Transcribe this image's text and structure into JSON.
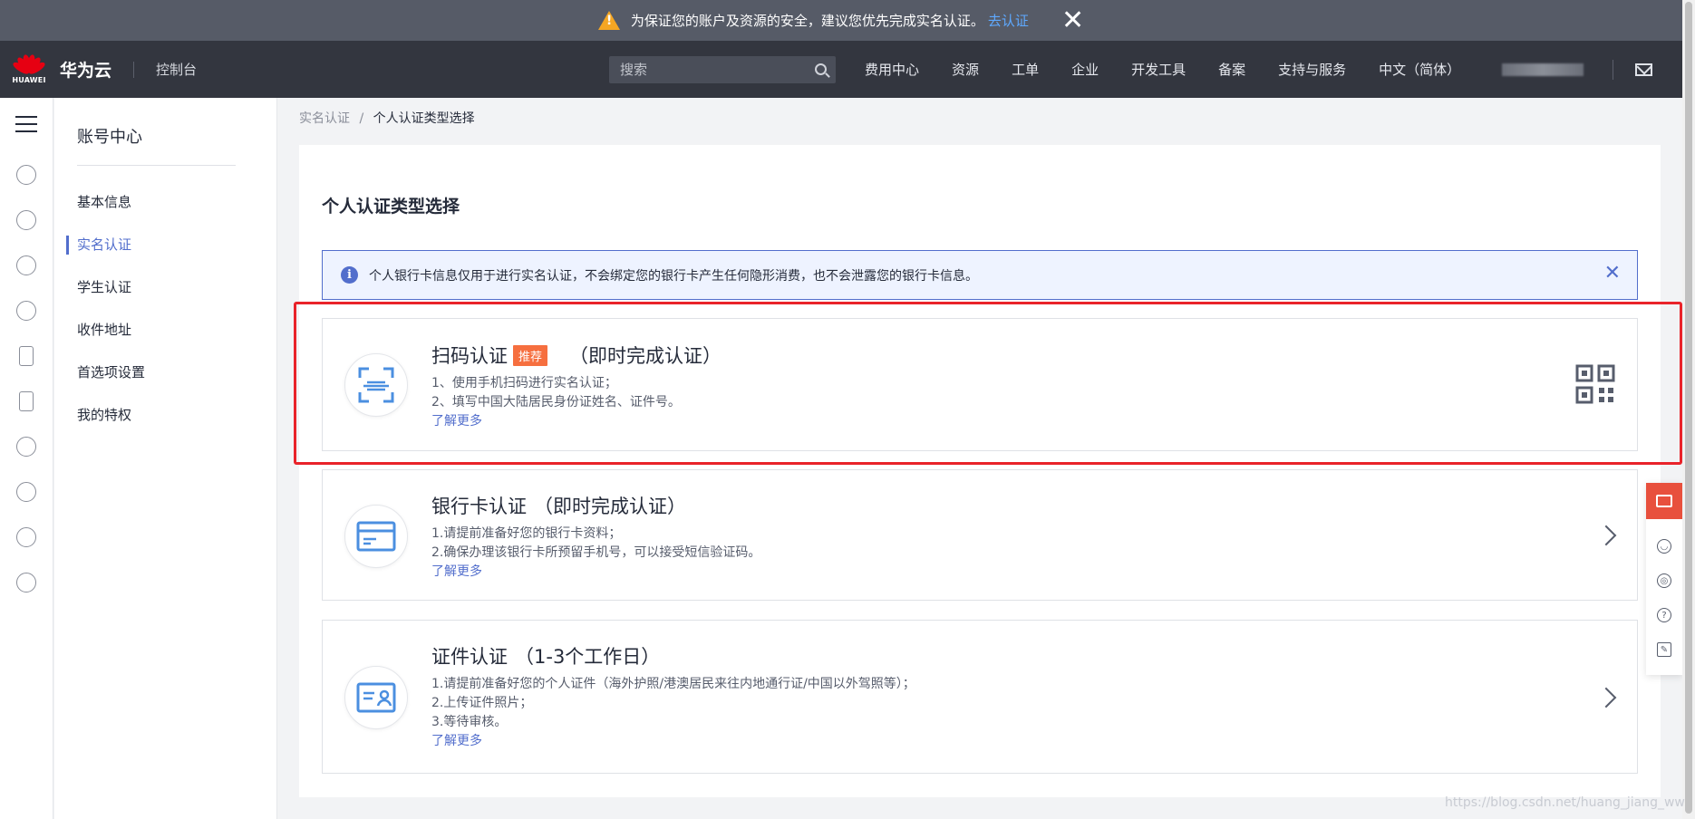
{
  "banner": {
    "message": "为保证您的账户及资源的安全，建议您优先完成实名认证。",
    "link": "去认证"
  },
  "header": {
    "logo_text": "HUAWEI",
    "brand": "华为云",
    "console": "控制台",
    "search_placeholder": "搜索",
    "nav": [
      "费用中心",
      "资源",
      "工单",
      "企业",
      "开发工具",
      "备案",
      "支持与服务",
      "中文（简体）"
    ]
  },
  "sidebar": {
    "title": "账号中心",
    "items": [
      {
        "label": "基本信息"
      },
      {
        "label": "实名认证"
      },
      {
        "label": "学生认证"
      },
      {
        "label": "收件地址"
      },
      {
        "label": "首选项设置"
      },
      {
        "label": "我的特权"
      }
    ]
  },
  "breadcrumb": {
    "parent": "实名认证",
    "sep": "/",
    "current": "个人认证类型选择"
  },
  "main": {
    "title": "个人认证类型选择",
    "notice": "个人银行卡信息仅用于进行实名认证，不会绑定您的银行卡产生任何隐形消费，也不会泄露您的银行卡信息。",
    "cards": [
      {
        "title": "扫码认证",
        "badge": "推荐",
        "subtitle": "（即时完成认证）",
        "lines": [
          "1、使用手机扫码进行实名认证；",
          "2、填写中国大陆居民身份证姓名、证件号。"
        ],
        "more": "了解更多"
      },
      {
        "title": "银行卡认证",
        "subtitle": "（即时完成认证）",
        "lines": [
          "1.请提前准备好您的银行卡资料；",
          "2.确保办理该银行卡所预留手机号，可以接受短信验证码。"
        ],
        "more": "了解更多"
      },
      {
        "title": "证件认证",
        "subtitle": "（1-3个工作日）",
        "lines": [
          "1.请提前准备好您的个人证件（海外护照/港澳居民来往内地通行证/中国以外驾照等）；",
          "2.上传证件照片；",
          "3.等待审核。"
        ],
        "more": "了解更多"
      }
    ]
  },
  "watermark": "https://blog.csdn.net/huang_jiang_ww",
  "colors": {
    "accent": "#526ecc",
    "badge": "#f66f3f",
    "highlight": "#e9232a",
    "header": "#33363f",
    "banner": "#565b67"
  }
}
